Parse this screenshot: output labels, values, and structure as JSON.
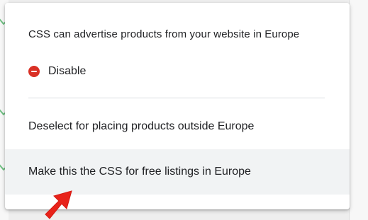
{
  "menu": {
    "header": "CSS can advertise products from your website in Europe",
    "disable_label": "Disable",
    "items": [
      {
        "label": "Deselect for placing products outside Europe"
      },
      {
        "label": "Make this the CSS for free listings in Europe"
      }
    ]
  },
  "icons": {
    "disable": "remove-circle-icon",
    "annotation": "red-arrow-icon",
    "background_marks": "check-icon"
  },
  "colors": {
    "disable_icon": "#d93025",
    "text": "#202124",
    "hover_background": "#f1f3f4",
    "divider": "#dadce0",
    "arrow": "#e8231a",
    "background_check": "#37a852"
  }
}
